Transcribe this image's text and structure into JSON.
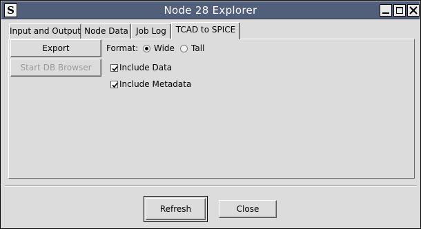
{
  "window": {
    "title": "Node 28 Explorer",
    "app_icon_letter": "S",
    "controls": [
      "minimize",
      "maximize",
      "close"
    ]
  },
  "tabs": [
    {
      "label": "Input and Output",
      "active": false
    },
    {
      "label": "Node Data",
      "active": false
    },
    {
      "label": "Job Log",
      "active": false
    },
    {
      "label": "TCAD to SPICE",
      "active": true
    }
  ],
  "panel": {
    "export_button": "Export",
    "db_browser_button": "Start DB Browser",
    "db_browser_enabled": false,
    "format_label": "Format:",
    "format_options": [
      {
        "label": "Wide",
        "selected": true
      },
      {
        "label": "Tall",
        "selected": false
      }
    ],
    "include_data": {
      "label": "Include Data",
      "checked": true
    },
    "include_metadata": {
      "label": "Include Metadata",
      "checked": true
    }
  },
  "footer": {
    "refresh_button": "Refresh",
    "close_button": "Close"
  },
  "icons": {
    "app": "app-s-icon",
    "minimize": "minimize-icon",
    "maximize": "maximize-icon",
    "close": "close-icon"
  }
}
